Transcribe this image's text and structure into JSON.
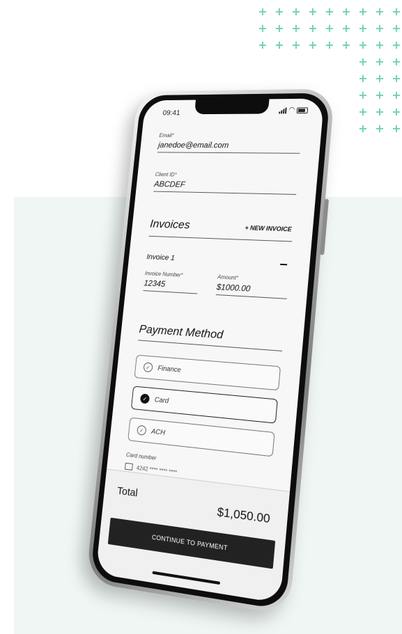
{
  "status_bar": {
    "time": "09:41",
    "icons": [
      "signal-icon",
      "wifi-icon",
      "battery-icon"
    ]
  },
  "form": {
    "email": {
      "label": "Email",
      "required_mark": "*",
      "value": "janedoe@email.com"
    },
    "client_id": {
      "label": "Client ID",
      "required_mark": "*",
      "value": "ABCDEF"
    }
  },
  "invoices": {
    "title": "Invoices",
    "new_invoice": "+ NEW INVOICE",
    "items": [
      {
        "title": "Invoice 1",
        "collapse_icon": "minus-icon",
        "invoice_number": {
          "label": "Invoice Number",
          "required_mark": "*",
          "value": "12345"
        },
        "amount": {
          "label": "Amount",
          "required_mark": "*",
          "value": "$1000.00"
        }
      }
    ]
  },
  "payment_method": {
    "title": "Payment Method",
    "options": [
      {
        "label": "Finance",
        "selected": false
      },
      {
        "label": "Card",
        "selected": true
      },
      {
        "label": "ACH",
        "selected": false
      }
    ],
    "card_number": {
      "label": "Card number",
      "value": "4242 **** **** ****"
    }
  },
  "footer": {
    "total_label": "Total",
    "total_value": "$1,050.00",
    "continue_label": "CONTINUE TO PAYMENT"
  },
  "colors": {
    "accent_plus": "#6fd2b3",
    "panel_bg": "#eff6f3",
    "button_bg": "#222222"
  }
}
